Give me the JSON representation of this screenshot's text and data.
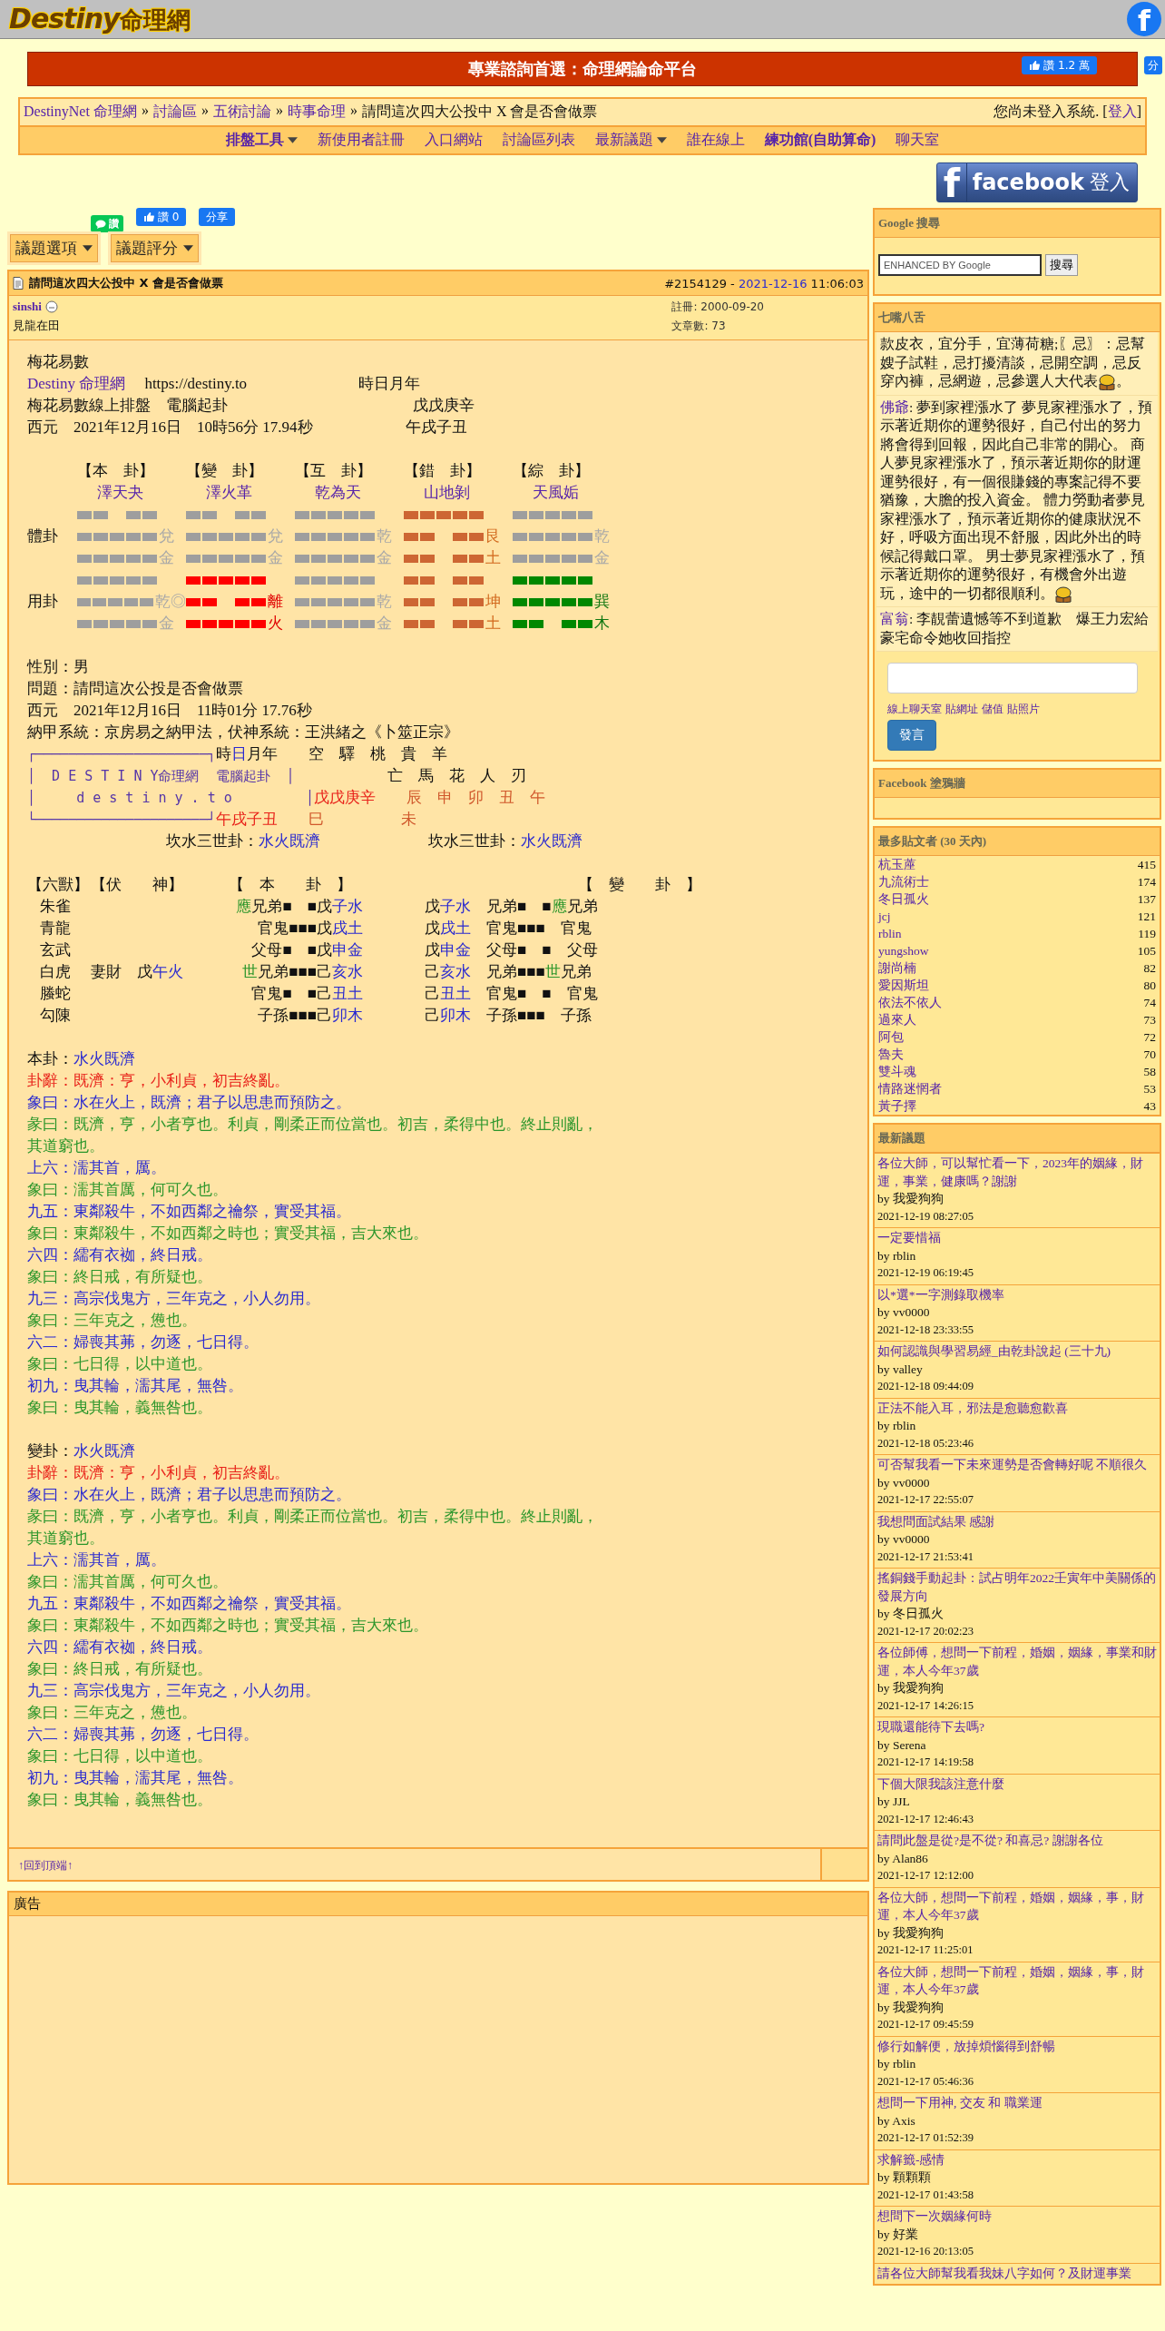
{
  "header": {
    "logo_latin": "Destiny",
    "logo_cjk": "命理網",
    "facebook_glyph": "f"
  },
  "banner": {
    "title": "專業諮詢首選：命理網論命平台",
    "like_label": "讚",
    "like_count": "1.2 萬",
    "share_label": "分"
  },
  "breadcrumb": {
    "items": [
      {
        "text": "DestinyNet 命理網",
        "kind": "link"
      },
      {
        "text": "»",
        "kind": "separator"
      },
      {
        "text": "討論區",
        "kind": "link"
      },
      {
        "text": "»",
        "kind": "separator"
      },
      {
        "text": "五術討論",
        "kind": "link"
      },
      {
        "text": "»",
        "kind": "separator"
      },
      {
        "text": "時事命理",
        "kind": "link"
      },
      {
        "text": "»",
        "kind": "separator"
      },
      {
        "text": "請問這次四大公投中 X 會是否會做票",
        "kind": "current"
      }
    ],
    "login_status": "您尚未登入系統. [",
    "login_link": "登入",
    "login_tail": "]"
  },
  "nav": [
    {
      "label": "排盤工具",
      "dropdown": true,
      "bold": true
    },
    {
      "label": "新使用者註冊",
      "dropdown": false,
      "bold": false
    },
    {
      "label": "入口網站",
      "dropdown": false,
      "bold": false
    },
    {
      "label": "討論區列表",
      "dropdown": false,
      "bold": false
    },
    {
      "label": "最新議題",
      "dropdown": true,
      "bold": false
    },
    {
      "label": "誰在線上",
      "dropdown": false,
      "bold": false
    },
    {
      "label": "練功館(自助算命)",
      "dropdown": false,
      "bold": true
    },
    {
      "label": "聊天室",
      "dropdown": false,
      "bold": false
    }
  ],
  "facebook_login": {
    "glyph": "f",
    "brand": "facebook",
    "label": "登入"
  },
  "social": {
    "line_label": "讚",
    "like_label": "讚",
    "like_count": "0",
    "share_label": "分享"
  },
  "topic_buttons": [
    "議題選項",
    "議題評分"
  ],
  "post": {
    "title": "請問這次四大公投中 X 會是否會做票",
    "number": "#2154129 -",
    "date": "2021-12-16",
    "time": "11:06:03",
    "author": "sinshi",
    "rank": "見龍在田",
    "registered": "註冊: 2000-09-20",
    "post_count": "文章數: 73",
    "intro": [
      [
        {
          "text": "梅花易數",
          "kind": "plain"
        }
      ],
      [
        {
          "text": "Destiny 命理網",
          "kind": "purple"
        },
        {
          "text": "　 https://destiny.to　　　　　　　 時日月年",
          "kind": "plain"
        }
      ],
      [
        {
          "text": "梅花易數線上排盤　電腦起卦　　　　　　　　　　　　戊戊庚辛",
          "kind": "plain"
        }
      ],
      [
        {
          "text": "西元　2021年12月16日　10時56分 17.94秒　　　　　　午戌子丑",
          "kind": "plain"
        }
      ]
    ],
    "hexagram_row_labels": [
      "體卦",
      "用卦"
    ],
    "hexagrams": [
      {
        "bracket": "【本　卦】",
        "name": "澤天夬",
        "trigrams": [
          {
            "kind": "grey",
            "name": "兌",
            "element": "金",
            "lines": [
              {
                "kind": "yin"
              },
              {
                "kind": "yang"
              },
              {
                "kind": "yang"
              }
            ]
          },
          {
            "kind": "grey",
            "name": "乾◎",
            "element": "金",
            "lines": [
              {
                "kind": "yang"
              },
              {
                "kind": "yang"
              },
              {
                "kind": "yang"
              }
            ]
          }
        ]
      },
      {
        "bracket": "【變　卦】",
        "name": "澤火革",
        "trigrams": [
          {
            "kind": "grey",
            "name": "兌",
            "element": "金",
            "lines": [
              {
                "kind": "yin"
              },
              {
                "kind": "yang"
              },
              {
                "kind": "yang"
              }
            ]
          },
          {
            "kind": "red",
            "name": "離",
            "element": "火",
            "lines": [
              {
                "kind": "yang"
              },
              {
                "kind": "yin"
              },
              {
                "kind": "yang"
              }
            ]
          }
        ]
      },
      {
        "bracket": "【互　卦】",
        "name": "乾為天",
        "trigrams": [
          {
            "kind": "grey",
            "name": "乾",
            "element": "金",
            "lines": [
              {
                "kind": "yang"
              },
              {
                "kind": "yang"
              },
              {
                "kind": "yang"
              }
            ]
          },
          {
            "kind": "grey",
            "name": "乾",
            "element": "金",
            "lines": [
              {
                "kind": "yang"
              },
              {
                "kind": "yang"
              },
              {
                "kind": "yang"
              }
            ]
          }
        ]
      },
      {
        "bracket": "【錯　卦】",
        "name": "山地剝",
        "trigrams": [
          {
            "kind": "brown",
            "name": "艮",
            "element": "土",
            "lines": [
              {
                "kind": "yang"
              },
              {
                "kind": "yin"
              },
              {
                "kind": "yin"
              }
            ]
          },
          {
            "kind": "brown",
            "name": "坤",
            "element": "土",
            "lines": [
              {
                "kind": "yin"
              },
              {
                "kind": "yin"
              },
              {
                "kind": "yin"
              }
            ]
          }
        ]
      },
      {
        "bracket": "【綜　卦】",
        "name": "天風姤",
        "trigrams": [
          {
            "kind": "grey",
            "name": "乾",
            "element": "金",
            "lines": [
              {
                "kind": "yang"
              },
              {
                "kind": "yang"
              },
              {
                "kind": "yang"
              }
            ]
          },
          {
            "kind": "green",
            "name": "巽",
            "element": "木",
            "lines": [
              {
                "kind": "yang"
              },
              {
                "kind": "yang"
              },
              {
                "kind": "yin"
              }
            ]
          }
        ]
      }
    ],
    "details": [
      [
        {
          "text": "性別：男",
          "kind": "plain"
        }
      ],
      [
        {
          "text": "問題：請問這次公投是否會做票",
          "kind": "plain"
        }
      ],
      [
        {
          "text": "西元　2021年12月16日　11時01分 17.76秒",
          "kind": "plain"
        }
      ],
      [
        {
          "text": "納甲系統：京房易之納甲法，伏神系統：王洪緒之《卜筮正宗》",
          "kind": "plain"
        }
      ]
    ],
    "chart_box": [
      [
        {
          "text": "┌─────────────────────┐",
          "kind": "box"
        },
        {
          "text": "時",
          "kind": "plain"
        },
        {
          "text": "日",
          "kind": "blue"
        },
        {
          "text": "月年　　空　驛　桃　貴　羊",
          "kind": "plain"
        }
      ],
      [
        {
          "text": "│  D E S T I N Y命理網  電腦起卦  │",
          "kind": "box"
        },
        {
          "text": "　　　　　　亡　馬　花　人　刃",
          "kind": "plain"
        }
      ],
      [
        {
          "text": "│     d e s t i n y . t o         │",
          "kind": "box"
        },
        {
          "text": "戊戊庚辛",
          "kind": "red"
        },
        {
          "text": "　　辰　申　卯　丑　午",
          "kind": "brown"
        }
      ],
      [
        {
          "text": "└─────────────────────┘",
          "kind": "box"
        },
        {
          "text": "午戌子丑",
          "kind": "red"
        },
        {
          "text": "　　巳　　　　　未",
          "kind": "brown"
        }
      ],
      [
        {
          "text": "　　　　　　　　　坎水三世卦：",
          "kind": "plain"
        },
        {
          "text": "水火既濟",
          "kind": "blue"
        },
        {
          "text": "　　　　　　　坎水三世卦：",
          "kind": "plain"
        },
        {
          "text": "水火既濟",
          "kind": "blue"
        }
      ]
    ],
    "table": {
      "headers": [
        "【六獸】",
        "【伏　　神】",
        "【　本　　卦　】",
        "【　變　　卦　】"
      ],
      "rows": [
        {
          "animal": "朱雀",
          "fushen": [],
          "ben": [
            {
              "text": "應",
              "kind": "green"
            },
            {
              "text": "兄弟■　■戊",
              "kind": "plain"
            },
            {
              "text": "子水",
              "kind": "blue"
            }
          ],
          "bian": [
            {
              "text": "戊",
              "kind": "plain"
            },
            {
              "text": "子水",
              "kind": "blue"
            },
            {
              "text": "　兄弟■　■",
              "kind": "plain"
            },
            {
              "text": "應",
              "kind": "green"
            },
            {
              "text": "兄弟",
              "kind": "plain"
            }
          ]
        },
        {
          "animal": "青龍",
          "fushen": [],
          "ben": [
            {
              "text": "官鬼■■■戊",
              "kind": "plain"
            },
            {
              "text": "戌土",
              "kind": "blue"
            }
          ],
          "bian": [
            {
              "text": "戊",
              "kind": "plain"
            },
            {
              "text": "戌土",
              "kind": "blue"
            },
            {
              "text": "　官鬼■■■　官鬼",
              "kind": "plain"
            }
          ]
        },
        {
          "animal": "玄武",
          "fushen": [],
          "ben": [
            {
              "text": "父母■　■戊",
              "kind": "plain"
            },
            {
              "text": "申金",
              "kind": "blue"
            }
          ],
          "bian": [
            {
              "text": "戊",
              "kind": "plain"
            },
            {
              "text": "申金",
              "kind": "blue"
            },
            {
              "text": "　父母■　■　父母",
              "kind": "plain"
            }
          ]
        },
        {
          "animal": "白虎",
          "fushen": [
            {
              "text": "妻財　戊",
              "kind": "plain"
            },
            {
              "text": "午火",
              "kind": "blue"
            }
          ],
          "ben": [
            {
              "text": "世",
              "kind": "green"
            },
            {
              "text": "兄弟■■■己",
              "kind": "plain"
            },
            {
              "text": "亥水",
              "kind": "blue"
            }
          ],
          "bian": [
            {
              "text": "己",
              "kind": "plain"
            },
            {
              "text": "亥水",
              "kind": "blue"
            },
            {
              "text": "　兄弟■■■",
              "kind": "plain"
            },
            {
              "text": "世",
              "kind": "green"
            },
            {
              "text": "兄弟",
              "kind": "plain"
            }
          ]
        },
        {
          "animal": "螣蛇",
          "fushen": [],
          "ben": [
            {
              "text": "官鬼■　■己",
              "kind": "plain"
            },
            {
              "text": "丑土",
              "kind": "blue"
            }
          ],
          "bian": [
            {
              "text": "己",
              "kind": "plain"
            },
            {
              "text": "丑土",
              "kind": "blue"
            },
            {
              "text": "　官鬼■　■　官鬼",
              "kind": "plain"
            }
          ]
        },
        {
          "animal": "勾陳",
          "fushen": [],
          "ben": [
            {
              "text": "子孫■■■己",
              "kind": "plain"
            },
            {
              "text": "卯木",
              "kind": "blue"
            }
          ],
          "bian": [
            {
              "text": "己",
              "kind": "plain"
            },
            {
              "text": "卯木",
              "kind": "blue"
            },
            {
              "text": "　子孫■■■　子孫",
              "kind": "plain"
            }
          ]
        }
      ]
    },
    "sections": [
      [
        [
          {
            "text": "本卦：",
            "kind": "plain"
          },
          {
            "text": "水火既濟",
            "kind": "blue"
          }
        ],
        [
          {
            "text": "卦辭：既濟：亨，小利貞，初吉終亂。",
            "kind": "red"
          }
        ],
        [
          {
            "text": "象曰：水在火上，既濟；君子以思患而預防之。",
            "kind": "blue"
          }
        ],
        [
          {
            "text": "彖曰：既濟，亨，小者亨也。利貞，剛柔正而位當也。初吉，柔得中也。終止則亂，",
            "kind": "green"
          }
        ],
        [
          {
            "text": "其道窮也。",
            "kind": "green"
          }
        ],
        [
          {
            "text": "上六：濡其首，厲。",
            "kind": "blue"
          }
        ],
        [
          {
            "text": "象曰：濡其首厲，何可久也。",
            "kind": "green"
          }
        ],
        [
          {
            "text": "九五：東鄰殺牛，不如西鄰之禴祭，實受其福。",
            "kind": "blue"
          }
        ],
        [
          {
            "text": "象曰：東鄰殺牛，不如西鄰之時也；實受其福，吉大來也。",
            "kind": "green"
          }
        ],
        [
          {
            "text": "六四：繻有衣袽，終日戒。",
            "kind": "blue"
          }
        ],
        [
          {
            "text": "象曰：終日戒，有所疑也。",
            "kind": "green"
          }
        ],
        [
          {
            "text": "九三：高宗伐鬼方，三年克之，小人勿用。",
            "kind": "blue"
          }
        ],
        [
          {
            "text": "象曰：三年克之，憊也。",
            "kind": "green"
          }
        ],
        [
          {
            "text": "六二：婦喪其茀，勿逐，七日得。",
            "kind": "blue"
          }
        ],
        [
          {
            "text": "象曰：七日得，以中道也。",
            "kind": "green"
          }
        ],
        [
          {
            "text": "初九：曳其輪，濡其尾，無咎。",
            "kind": "blue"
          }
        ],
        [
          {
            "text": "象曰：曳其輪，義無咎也。",
            "kind": "green"
          }
        ]
      ],
      [
        [
          {
            "text": "變卦：",
            "kind": "plain"
          },
          {
            "text": "水火既濟",
            "kind": "blue"
          }
        ],
        [
          {
            "text": "卦辭：既濟：亨，小利貞，初吉終亂。",
            "kind": "red"
          }
        ],
        [
          {
            "text": "象曰：水在火上，既濟；君子以思患而預防之。",
            "kind": "blue"
          }
        ],
        [
          {
            "text": "彖曰：既濟，亨，小者亨也。利貞，剛柔正而位當也。初吉，柔得中也。終止則亂，",
            "kind": "green"
          }
        ],
        [
          {
            "text": "其道窮也。",
            "kind": "green"
          }
        ],
        [
          {
            "text": "上六：濡其首，厲。",
            "kind": "blue"
          }
        ],
        [
          {
            "text": "象曰：濡其首厲，何可久也。",
            "kind": "green"
          }
        ],
        [
          {
            "text": "九五：東鄰殺牛，不如西鄰之禴祭，實受其福。",
            "kind": "blue"
          }
        ],
        [
          {
            "text": "象曰：東鄰殺牛，不如西鄰之時也；實受其福，吉大來也。",
            "kind": "green"
          }
        ],
        [
          {
            "text": "六四：繻有衣袽，終日戒。",
            "kind": "blue"
          }
        ],
        [
          {
            "text": "象曰：終日戒，有所疑也。",
            "kind": "green"
          }
        ],
        [
          {
            "text": "九三：高宗伐鬼方，三年克之，小人勿用。",
            "kind": "blue"
          }
        ],
        [
          {
            "text": "象曰：三年克之，憊也。",
            "kind": "green"
          }
        ],
        [
          {
            "text": "六二：婦喪其茀，勿逐，七日得。",
            "kind": "blue"
          }
        ],
        [
          {
            "text": "象曰：七日得，以中道也。",
            "kind": "green"
          }
        ],
        [
          {
            "text": "初九：曳其輪，濡其尾，無咎。",
            "kind": "blue"
          }
        ],
        [
          {
            "text": "象曰：曳其輪，義無咎也。",
            "kind": "green"
          }
        ]
      ]
    ],
    "back_to_top": "↑回到頂端↑"
  },
  "ad_panel": {
    "title": "廣告"
  },
  "sidebar": {
    "google": {
      "title": "Google 搜尋",
      "placeholder": "ENHANCED BY Google",
      "button": "搜尋"
    },
    "chat": {
      "title": "七嘴八舌",
      "messages": [
        {
          "text": "款皮衣，宜分手，宜薄荷糖;〖忌〗：忌幫嫂子試鞋，忌打擾清談，忌開空調，忌反穿內褲，忌網遊，忌參選人大代表",
          "emoticon": true,
          "tail": "。"
        },
        {
          "author": "佛爺",
          "text": ": 夢到家裡漲水了 夢見家裡漲水了，預示著近期你的運勢很好，自己付出的努力將會得到回報，因此自己非常的開心。 商人夢見家裡漲水了，預示著近期你的財運運勢很好，有一個很賺錢的專案記得不要猶豫，大膽的投入資金。 體力勞動者夢見家裡漲水了，預示著近期你的健康狀況不好，呼吸方面出現不舒服，因此外出的時候記得戴口罩。 男士夢見家裡漲水了，預示著近期你的運勢很好，有機會外出遊玩，途中的一切都很順利。",
          "emoticon": true
        },
        {
          "author": "富翁",
          "text": ": 李靚蕾遺憾等不到道歉　爆王力宏給豪宅命令她收回指控",
          "emoticon": false
        }
      ],
      "links": [
        "線上聊天室",
        "貼網址",
        "儲值",
        "貼照片"
      ],
      "button": "發言"
    },
    "facebook_wall": {
      "title": "Facebook 塗鴉牆"
    },
    "top_posters": {
      "title": "最多貼文者 (30 天內)",
      "rows": [
        {
          "name": "杭玉蓙",
          "count": "415"
        },
        {
          "name": "九流術士",
          "count": "174"
        },
        {
          "name": "冬日孤火",
          "count": "137"
        },
        {
          "name": "jcj",
          "count": "121"
        },
        {
          "name": "rblin",
          "count": "119"
        },
        {
          "name": "yungshow",
          "count": "105"
        },
        {
          "name": "謝尚楠",
          "count": "82"
        },
        {
          "name": "愛因斯坦",
          "count": "80"
        },
        {
          "name": "依法不依人",
          "count": "74"
        },
        {
          "name": "過來人",
          "count": "73"
        },
        {
          "name": "阿包",
          "count": "72"
        },
        {
          "name": "魯夫",
          "count": "70"
        },
        {
          "name": "雙斗魂",
          "count": "58"
        },
        {
          "name": "情路迷惘者",
          "count": "53"
        },
        {
          "name": "黃子擇",
          "count": "43"
        }
      ]
    },
    "latest_topics": {
      "title": "最新議題",
      "items": [
        {
          "title": "各位大師，可以幫忙看一下，2023年的姻緣，財運，事業，健康嗎？謝謝",
          "by": "by 我愛狗狗",
          "time": "2021-12-19 08:27:05"
        },
        {
          "title": "一定要惜福",
          "by": "by rblin",
          "time": "2021-12-19 06:19:45"
        },
        {
          "title": "以*選*一字測錄取機率",
          "by": "by vv0000",
          "time": "2021-12-18 23:33:55"
        },
        {
          "title": "如何認識與學習易經_由乾卦說起 (三十九)",
          "by": "by valley",
          "time": "2021-12-18 09:44:09"
        },
        {
          "title": "正法不能入耳，邪法是愈聽愈歡喜",
          "by": "by rblin",
          "time": "2021-12-18 05:23:46"
        },
        {
          "title": "可否幫我看一下未來運勢是否會轉好呢 不順很久",
          "by": "by vv0000",
          "time": "2021-12-17 22:55:07"
        },
        {
          "title": "我想問面試結果 感謝",
          "by": "by vv0000",
          "time": "2021-12-17 21:53:41"
        },
        {
          "title": "搖銅錢手動起卦：試占明年2022壬寅年中美關係的發展方向",
          "by": "by 冬日孤火",
          "time": "2021-12-17 20:02:23"
        },
        {
          "title": "各位師傅，想問一下前程，婚姻，姻緣，事業和財運，本人今年37歲",
          "by": "by 我愛狗狗",
          "time": "2021-12-17 14:26:15"
        },
        {
          "title": "現職還能待下去嗎?",
          "by": "by Serena",
          "time": "2021-12-17 14:19:58"
        },
        {
          "title": "下個大限我該注意什麼",
          "by": "by JJL",
          "time": "2021-12-17 12:46:43"
        },
        {
          "title": "請問此盤是從?是不從? 和喜忌? 謝謝各位",
          "by": "by Alan86",
          "time": "2021-12-17 12:12:00"
        },
        {
          "title": "各位大師，想問一下前程，婚姻，姻緣，事，財運，本人今年37歲",
          "by": "by 我愛狗狗",
          "time": "2021-12-17 11:25:01"
        },
        {
          "title": "各位大師，想問一下前程，婚姻，姻緣，事，財運，本人今年37歲",
          "by": "by 我愛狗狗",
          "time": "2021-12-17 09:45:59"
        },
        {
          "title": "修行如解便，放掉煩惱得到舒暢",
          "by": "by rblin",
          "time": "2021-12-17 05:46:36"
        },
        {
          "title": "想問一下用神, 交友 和 職業運",
          "by": "by Axis",
          "time": "2021-12-17 01:52:39"
        },
        {
          "title": "求解籤-感情",
          "by": "by 顆顆顆",
          "time": "2021-12-17 01:43:58"
        },
        {
          "title": "想問下一次姻緣何時",
          "by": "by 好業",
          "time": "2021-12-16 20:13:05"
        },
        {
          "title": "請各位大師幫我看我妹八字如何？及財運事業"
        }
      ]
    }
  }
}
